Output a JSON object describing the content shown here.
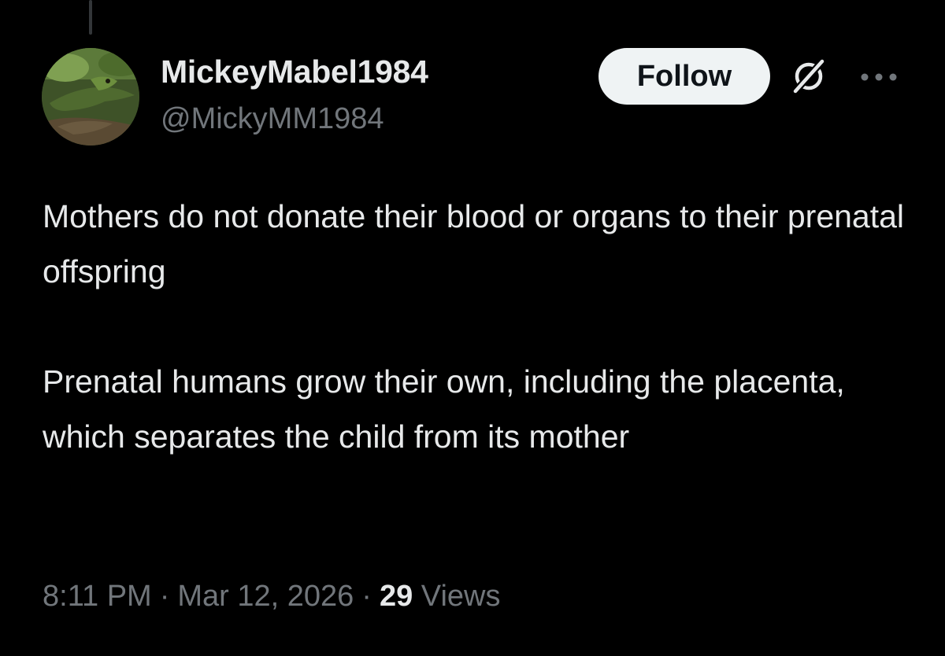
{
  "author": {
    "display_name": "MickeyMabel1984",
    "handle": "@MickyMM1984",
    "avatar_icon": "avatar-crocodile-photo"
  },
  "actions": {
    "follow_label": "Follow",
    "grok_icon": "grok-icon",
    "more_icon": "more-icon"
  },
  "tweet": {
    "paragraphs": [
      "Mothers do not donate their blood or organs to their prenatal offspring",
      "Prenatal humans grow their own, including the placenta, which separates the child from its mother"
    ],
    "time": "8:11 PM",
    "separator": "·",
    "date": "Mar 12, 2026",
    "views_count": "29",
    "views_label": "Views"
  },
  "colors": {
    "background": "#000000",
    "primary_text": "#e7e9ea",
    "secondary_text": "#71767b",
    "follow_bg": "#eff3f4",
    "follow_text": "#0f1419"
  }
}
